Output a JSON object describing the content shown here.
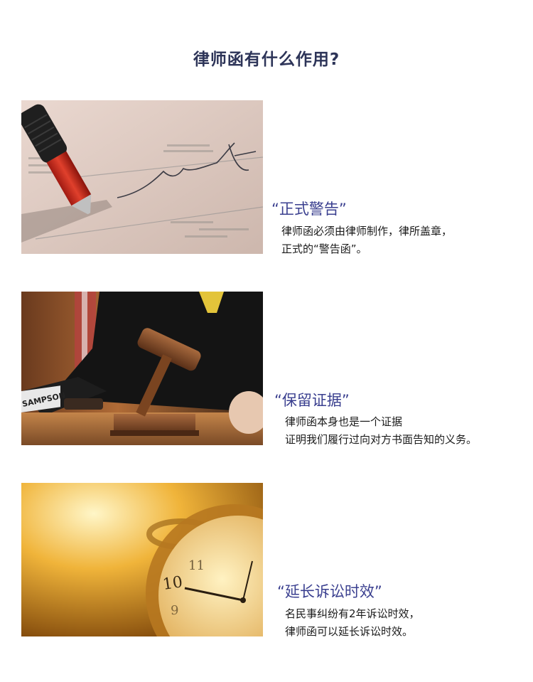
{
  "title": "律师函有什么作用?",
  "sections": [
    {
      "heading": "“正式警告”",
      "lines": [
        "律师函必须由律师制作，律所盖章，",
        "正式的“警告函”。"
      ],
      "image": "pen-signing-document"
    },
    {
      "heading": "“保留证据”",
      "lines": [
        "律师函本身也是一个证据",
        "证明我们履行过向对方书面告知的义务。"
      ],
      "image": "judge-gavel",
      "image_text": "SAMPSON"
    },
    {
      "heading": "“延长诉讼时效”",
      "lines": [
        "名民事纠纷有2年诉讼时效，",
        "律师函可以延长诉讼时效。"
      ],
      "image": "pocket-watch",
      "image_text": [
        "10",
        "11",
        "9"
      ]
    }
  ]
}
